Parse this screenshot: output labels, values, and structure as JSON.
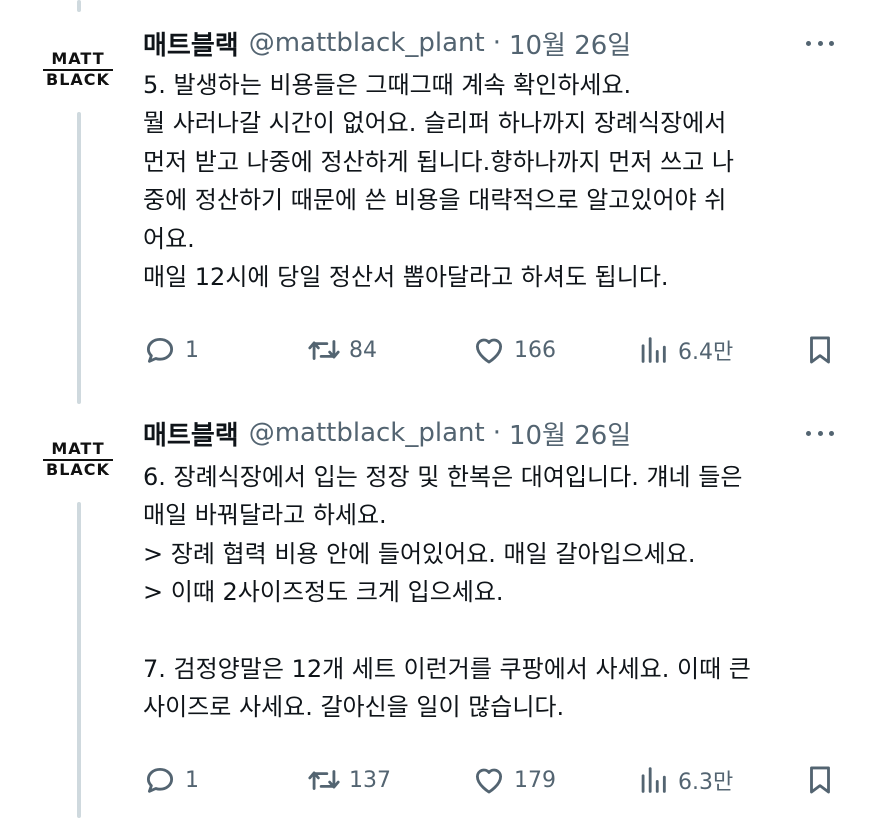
{
  "tweets": [
    {
      "avatar": {
        "line1": "MATT",
        "line2": "BLACK"
      },
      "author": {
        "name": "매트블랙",
        "handle": "@mattblack_plant",
        "separator": "·",
        "date": "10월 26일"
      },
      "lines": [
        "5. 발생하는 비용들은 그때그때 계속 확인하세요.",
        "뭘 사러나갈 시간이 없어요. 슬리퍼 하나까지 장례식장에서",
        "먼저 받고 나중에 정산하게 됩니다.향하나까지 먼저 쓰고 나",
        "중에 정산하기 때문에 쓴 비용을 대략적으로 알고있어야 쉬",
        "어요.",
        "매일 12시에 당일 정산서 뽑아달라고 하셔도 됩니다."
      ],
      "actions": {
        "replies": "1",
        "retweets": "84",
        "likes": "166",
        "views": "6.4만"
      }
    },
    {
      "avatar": {
        "line1": "MATT",
        "line2": "BLACK"
      },
      "author": {
        "name": "매트블랙",
        "handle": "@mattblack_plant",
        "separator": "·",
        "date": "10월 26일"
      },
      "lines": [
        "6. 장례식장에서 입는 정장 및 한복은 대여입니다. 걔네 들은",
        "매일 바꿔달라고 하세요.",
        "> 장례 협력 비용 안에 들어있어요. 매일 갈아입으세요.",
        "> 이때 2사이즈정도 크게 입으세요.",
        "",
        "7. 검정양말은 12개 세트 이런거를 쿠팡에서 사세요. 이때 큰",
        "사이즈로 사세요. 갈아신을 일이 많습니다."
      ],
      "actions": {
        "replies": "1",
        "retweets": "137",
        "likes": "179",
        "views": "6.3만"
      }
    }
  ],
  "colors": {
    "text": "#0f1419",
    "muted": "#536471",
    "thread_line": "#cfd9de"
  }
}
